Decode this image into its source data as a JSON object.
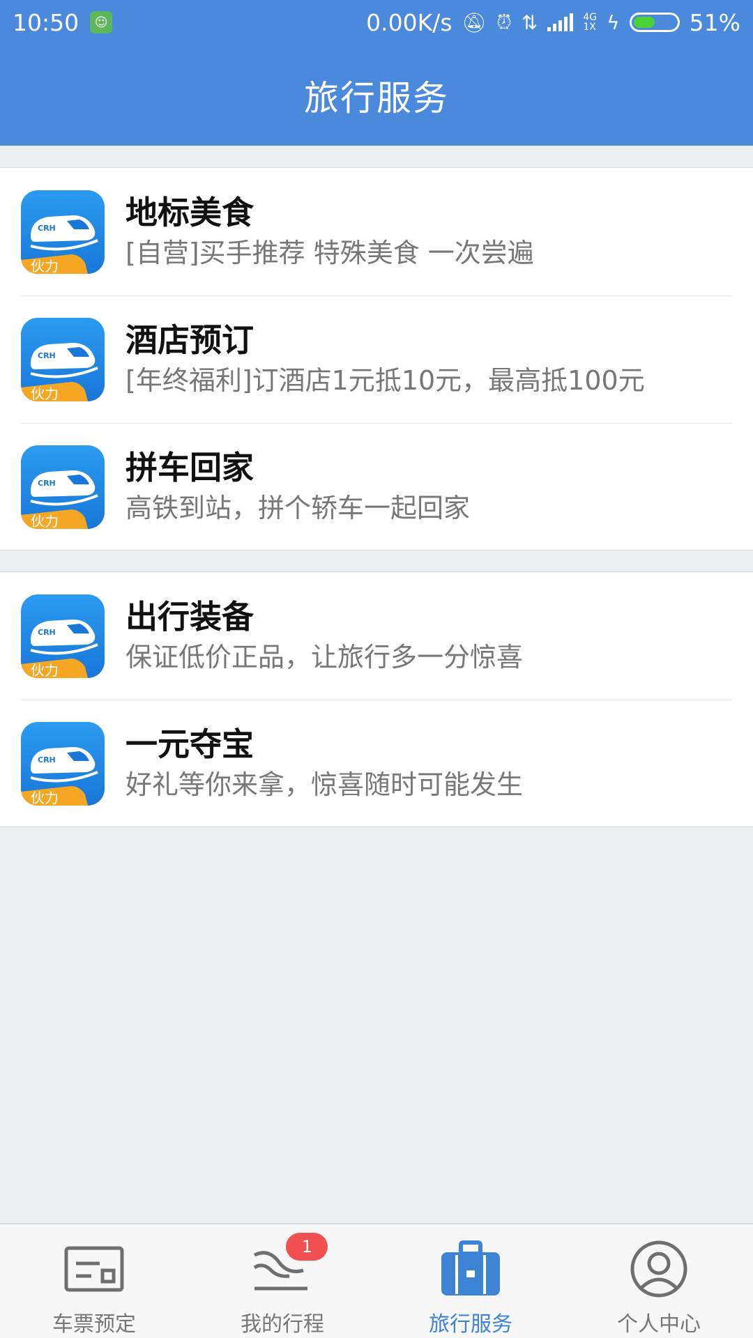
{
  "status_bar": {
    "time": "10:50",
    "net_speed": "0.00K/s",
    "net_tag_top": "4G",
    "net_tag_bottom": "1X",
    "battery_pct": "51%",
    "battery_level": 0.51
  },
  "header": {
    "title": "旅行服务"
  },
  "groups": [
    {
      "items": [
        {
          "title": "地标美食",
          "subtitle": "[自营]买手推荐 特殊美食 一次尝遍",
          "icon_badge": "伙力",
          "icon_mark": "CRH"
        },
        {
          "title": "酒店预订",
          "subtitle": "[年终福利]订酒店1元抵10元，最高抵100元",
          "icon_badge": "伙力",
          "icon_mark": "CRH"
        },
        {
          "title": "拼车回家",
          "subtitle": "高铁到站，拼个轿车一起回家",
          "icon_badge": "伙力",
          "icon_mark": "CRH"
        }
      ]
    },
    {
      "items": [
        {
          "title": "出行装备",
          "subtitle": "保证低价正品，让旅行多一分惊喜",
          "icon_badge": "伙力",
          "icon_mark": "CRH"
        },
        {
          "title": "一元夺宝",
          "subtitle": "好礼等你来拿，惊喜随时可能发生",
          "icon_badge": "伙力",
          "icon_mark": "CRH"
        }
      ]
    }
  ],
  "bottom_nav": [
    {
      "label": "车票预定",
      "icon": "ticket-icon",
      "active": false
    },
    {
      "label": "我的行程",
      "icon": "trip-route-icon",
      "active": false,
      "badge": "1"
    },
    {
      "label": "旅行服务",
      "icon": "suitcase-icon",
      "active": true
    },
    {
      "label": "个人中心",
      "icon": "user-profile-icon",
      "active": false
    }
  ],
  "colors": {
    "primary": "#4a89dc",
    "active_tab": "#3d84d6",
    "badge": "#f05050",
    "icon_orange": "#f5a623"
  }
}
